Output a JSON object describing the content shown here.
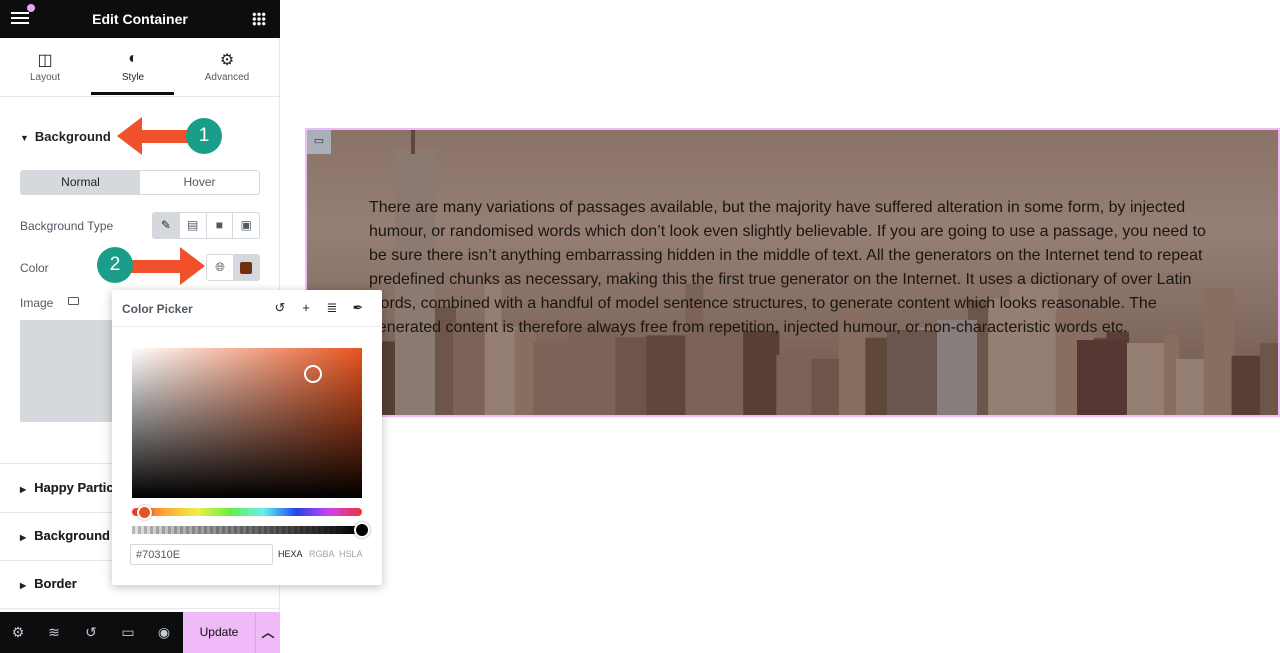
{
  "header": {
    "title": "Edit Container",
    "menu_icon": "hamburger-icon",
    "apps_icon": "grid-icon"
  },
  "tabs": [
    {
      "label": "Layout",
      "icon": "columns-icon"
    },
    {
      "label": "Style",
      "icon": "half-circle-icon",
      "active": true
    },
    {
      "label": "Advanced",
      "icon": "gear-icon"
    }
  ],
  "background_section": {
    "title": "Background",
    "state_tabs": [
      "Normal",
      "Hover"
    ],
    "active_state": "Normal",
    "type_label": "Background Type",
    "type_options": [
      "classic",
      "gradient",
      "video",
      "slideshow"
    ],
    "active_type": "classic",
    "color_label": "Color",
    "color_value": "#70310E",
    "image_label": "Image"
  },
  "sections": [
    "Happy Particles",
    "Background Overlay",
    "Border"
  ],
  "sections_visible": [
    "Happy Partic",
    "Background",
    "Border"
  ],
  "color_picker": {
    "title": "Color Picker",
    "hex_value": "#70310E",
    "modes": [
      "HEXA",
      "RGBA",
      "HSLA"
    ],
    "active_mode": "HEXA",
    "tools": [
      "reset-icon",
      "add-icon",
      "global-colors-icon",
      "eyedropper-icon"
    ]
  },
  "bottom_bar": {
    "update_label": "Update",
    "icons": [
      "settings-icon",
      "layers-icon",
      "history-icon",
      "responsive-icon",
      "preview-icon"
    ]
  },
  "annotations": {
    "badge_1": "1",
    "badge_2": "2",
    "arrow_color": "#f0502a",
    "badge_color": "#1a9e8a"
  },
  "canvas": {
    "paragraph_lines": [
      "There are many variations of passages available, but the majority have suffered alteration in some form, by injected",
      "humour, or randomised words which don’t look even slightly believable. If you are going to use a passage, you need to",
      "be sure there isn’t anything embarrassing hidden in the middle of text. All the generators on the Internet tend to repeat",
      "predefined chunks as necessary, making this the first true generator on the Internet. It uses a dictionary of over Latin",
      "words, combined with a handful of model sentence structures, to generate content which looks reasonable. The",
      "generated content is therefore always free from repetition, injected humour, or non-characteristic words etc."
    ]
  },
  "colors": {
    "accent": "#f0b9f7",
    "panel_header": "#0c0d0e"
  }
}
